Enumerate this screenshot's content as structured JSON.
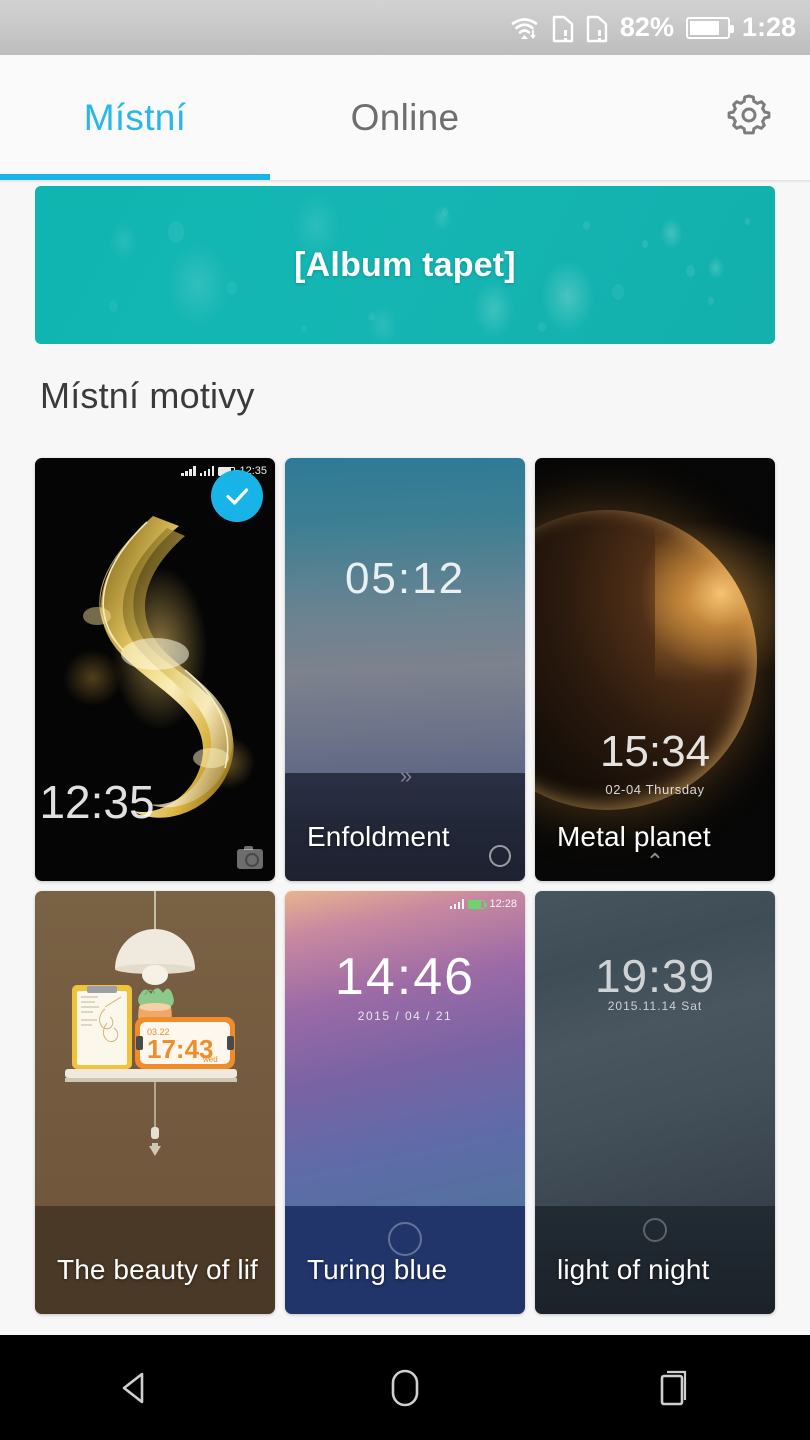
{
  "status_bar": {
    "wifi_icon": "wifi-icon",
    "sim1_icon": "sim-card-alert-icon",
    "sim2_icon": "sim-card-alert-icon",
    "battery_percent": "82%",
    "battery_icon": "battery-icon",
    "clock": "1:28"
  },
  "tabs": {
    "local_label": "Místní",
    "online_label": "Online",
    "active": "Místní",
    "active_color": "#18b4e8",
    "inactive_color": "#6e6e6e",
    "settings_icon": "gear-icon"
  },
  "banner": {
    "label": "[Album tapet]",
    "background_color": "#13b3b0"
  },
  "section": {
    "title": "Místní motivy"
  },
  "themes": [
    {
      "name": "",
      "clock": "12:35",
      "date": "",
      "selected": true,
      "check_icon": "check-icon",
      "check_color": "#18b4e8",
      "mini_status_clock": "12:35",
      "corner_icon": "camera-icon"
    },
    {
      "name": "Enfoldment",
      "clock": "05:12",
      "date": "",
      "selected": false,
      "unlock_hint": "»",
      "corner_icon": "circle-icon"
    },
    {
      "name": "Metal planet",
      "clock": "15:34",
      "date": "02-04  Thursday",
      "selected": false,
      "unlock_hint": "⌃",
      "corner_icon": "chevron-up-icon"
    },
    {
      "name": "The beauty of lif",
      "clock": "17:43",
      "date": "03.22",
      "weekday": "wed",
      "selected": false,
      "corner_icon": "arrow-down-icon"
    },
    {
      "name": "Turing blue",
      "clock": "14:46",
      "date": "2015 / 04 / 21",
      "selected": false,
      "mini_status_clock": "12:28",
      "corner_icon": "ring-icon"
    },
    {
      "name": "light of night",
      "clock": "19:39",
      "date": "2015.11.14 Sat",
      "selected": false,
      "corner_icon": "circle-icon"
    }
  ],
  "navbar": {
    "back_icon": "back-triangle-icon",
    "home_icon": "home-circle-icon",
    "recents_icon": "recents-squares-icon"
  }
}
